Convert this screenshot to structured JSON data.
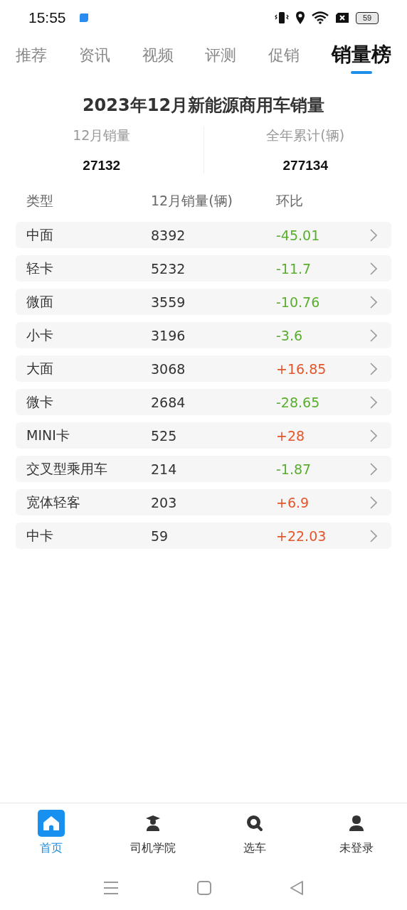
{
  "status_bar": {
    "time": "15:55",
    "battery": "59"
  },
  "tabs": [
    {
      "label": "推荐",
      "selected": false
    },
    {
      "label": "资讯",
      "selected": false
    },
    {
      "label": "视频",
      "selected": false
    },
    {
      "label": "评测",
      "selected": false
    },
    {
      "label": "促销",
      "selected": false
    },
    {
      "label": "销量榜",
      "selected": true
    }
  ],
  "title": "2023年12月新能源商用车销量",
  "stats": [
    {
      "label": "12月销量",
      "value": "27132"
    },
    {
      "label": "全年累计(辆)",
      "value": "277134"
    }
  ],
  "table": {
    "columns": [
      "类型",
      "12月销量(辆)",
      "环比"
    ],
    "rows": [
      {
        "type": "中面",
        "sales": "8392",
        "change": "-45.01",
        "color": "#5aae2e"
      },
      {
        "type": "轻卡",
        "sales": "5232",
        "change": "-11.7",
        "color": "#5aae2e"
      },
      {
        "type": "微面",
        "sales": "3559",
        "change": "-10.76",
        "color": "#5aae2e"
      },
      {
        "type": "小卡",
        "sales": "3196",
        "change": "-3.6",
        "color": "#5aae2e"
      },
      {
        "type": "大面",
        "sales": "3068",
        "change": "+16.85",
        "color": "#e5552a"
      },
      {
        "type": "微卡",
        "sales": "2684",
        "change": "-28.65",
        "color": "#5aae2e"
      },
      {
        "type": "MINI卡",
        "sales": "525",
        "change": "+28",
        "color": "#e5552a"
      },
      {
        "type": "交叉型乘用车",
        "sales": "214",
        "change": "-1.87",
        "color": "#5aae2e"
      },
      {
        "type": "宽体轻客",
        "sales": "203",
        "change": "+6.9",
        "color": "#e5552a"
      },
      {
        "type": "中卡",
        "sales": "59",
        "change": "+22.03",
        "color": "#e5552a"
      }
    ]
  },
  "bottom_nav": [
    {
      "label": "首页",
      "selected": true
    },
    {
      "label": "司机学院",
      "selected": false
    },
    {
      "label": "选车",
      "selected": false
    },
    {
      "label": "未登录",
      "selected": false
    }
  ]
}
